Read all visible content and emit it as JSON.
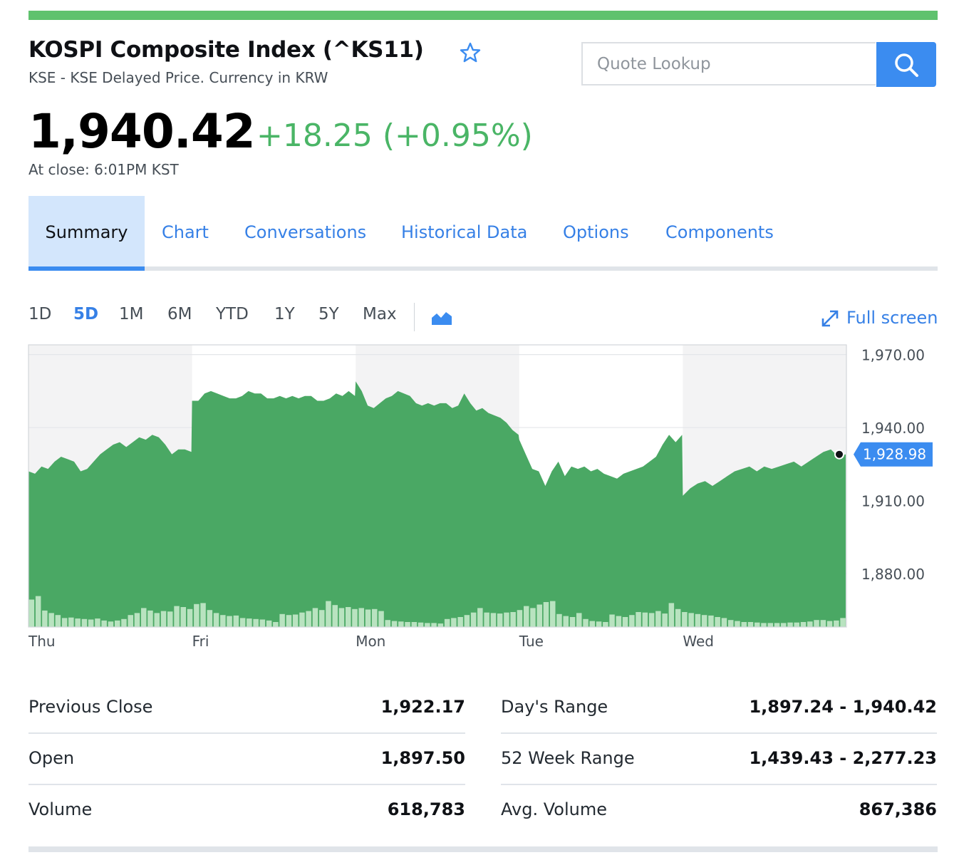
{
  "header": {
    "title": "KOSPI Composite Index (^KS11)",
    "subtitle": "KSE - KSE Delayed Price. Currency in KRW",
    "star_icon": "star-outline-icon"
  },
  "search": {
    "placeholder": "Quote Lookup",
    "button_icon": "search-icon"
  },
  "quote": {
    "price": "1,940.42",
    "change": "+18.25 (+0.95%)",
    "close_time": "At close: 6:01PM KST"
  },
  "tabs": [
    "Summary",
    "Chart",
    "Conversations",
    "Historical Data",
    "Options",
    "Components"
  ],
  "active_tab": "Summary",
  "ranges": [
    "1D",
    "5D",
    "1M",
    "6M",
    "YTD",
    "1Y",
    "5Y",
    "Max"
  ],
  "active_range": "5D",
  "chart_controls": {
    "chart_type_icon": "mountain-chart-icon",
    "fullscreen_icon": "expand-icon",
    "fullscreen_label": "Full screen"
  },
  "colors": {
    "accent": "#3b8cf0",
    "link": "#3680e6",
    "positive": "#4ab566",
    "area_fill": "#4aa864",
    "volume_bar": "#b9e3c0",
    "topbar": "#5fc26e"
  },
  "chart_data": {
    "type": "area",
    "ylim": [
      1858,
      1974
    ],
    "y_ticks": [
      "1,970.00",
      "1,940.00",
      "1,910.00",
      "1,880.00"
    ],
    "y_tick_values": [
      1970,
      1940,
      1910,
      1880
    ],
    "x_labels": [
      "Thu",
      "Fri",
      "Mon",
      "Tue",
      "Wed"
    ],
    "current_value": 1928.98,
    "current_label": "1,928.98",
    "grid": true,
    "shaded_days": [
      "Thu",
      "Mon",
      "Wed"
    ],
    "days": [
      {
        "day": "Thu",
        "values": [
          1922,
          1921,
          1924,
          1923,
          1926,
          1928,
          1927,
          1926,
          1922,
          1923,
          1926,
          1929,
          1931,
          1933,
          1934,
          1932,
          1934,
          1936,
          1935,
          1937,
          1936,
          1933,
          1929,
          1931,
          1931,
          1930
        ]
      },
      {
        "day": "Fri",
        "values": [
          1951,
          1951,
          1954,
          1955,
          1954,
          1953,
          1952,
          1952,
          1953,
          1955,
          1954,
          1954,
          1952,
          1952,
          1953,
          1952,
          1953,
          1952,
          1953,
          1953,
          1951,
          1951,
          1952,
          1954,
          1953,
          1955,
          1953
        ]
      },
      {
        "day": "Mon",
        "values": [
          1959,
          1955,
          1949,
          1948,
          1950,
          1952,
          1953,
          1955,
          1954,
          1953,
          1950,
          1949,
          1950,
          1949,
          1950,
          1950,
          1948,
          1949,
          1954,
          1950,
          1947,
          1948,
          1946,
          1945,
          1944,
          1942,
          1939,
          1937
        ]
      },
      {
        "day": "Tue",
        "values": [
          1935,
          1929,
          1923,
          1922,
          1916,
          1922,
          1926,
          1920,
          1924,
          1923,
          1924,
          1922,
          1923,
          1921,
          1920,
          1919,
          1921,
          1922,
          1923,
          1924,
          1926,
          1928,
          1933,
          1937,
          1934,
          1937
        ]
      },
      {
        "day": "Wed",
        "values": [
          1912,
          1915,
          1917,
          1918,
          1916,
          1918,
          1920,
          1922,
          1923,
          1924,
          1922,
          1924,
          1923,
          1924,
          1925,
          1926,
          1924,
          1926,
          1928,
          1930,
          1931,
          1928,
          1929
        ]
      }
    ],
    "volume_relative": [
      0.55,
      0.62,
      0.33,
      0.28,
      0.24,
      0.18,
      0.19,
      0.17,
      0.16,
      0.15,
      0.17,
      0.13,
      0.11,
      0.13,
      0.16,
      0.24,
      0.28,
      0.38,
      0.33,
      0.28,
      0.32,
      0.31,
      0.42,
      0.4,
      0.36,
      0.46,
      0.48,
      0.34,
      0.28,
      0.24,
      0.22,
      0.23,
      0.18,
      0.17,
      0.16,
      0.15,
      0.13,
      0.1,
      0.26,
      0.24,
      0.25,
      0.29,
      0.32,
      0.38,
      0.34,
      0.52,
      0.44,
      0.38,
      0.4,
      0.36,
      0.38,
      0.35,
      0.36,
      0.32,
      0.14,
      0.12,
      0.11,
      0.1,
      0.1,
      0.09,
      0.08,
      0.08,
      0.07,
      0.16,
      0.18,
      0.2,
      0.24,
      0.29,
      0.38,
      0.29,
      0.28,
      0.27,
      0.29,
      0.3,
      0.34,
      0.42,
      0.38,
      0.45,
      0.5,
      0.52,
      0.26,
      0.22,
      0.2,
      0.28,
      0.16,
      0.12,
      0.11,
      0.1,
      0.25,
      0.22,
      0.2,
      0.24,
      0.3,
      0.29,
      0.28,
      0.32,
      0.27,
      0.48,
      0.36,
      0.3,
      0.28,
      0.26,
      0.24,
      0.23,
      0.2,
      0.18,
      0.14,
      0.12,
      0.1,
      0.1,
      0.09,
      0.08,
      0.08,
      0.08,
      0.08,
      0.09,
      0.09,
      0.1,
      0.11,
      0.14,
      0.14,
      0.12,
      0.13,
      0.18
    ]
  },
  "stats": {
    "left": [
      {
        "label": "Previous Close",
        "value": "1,922.17"
      },
      {
        "label": "Open",
        "value": "1,897.50"
      },
      {
        "label": "Volume",
        "value": "618,783"
      }
    ],
    "right": [
      {
        "label": "Day's Range",
        "value": "1,897.24 - 1,940.42"
      },
      {
        "label": "52 Week Range",
        "value": "1,439.43 - 2,277.23"
      },
      {
        "label": "Avg. Volume",
        "value": "867,386"
      }
    ]
  }
}
